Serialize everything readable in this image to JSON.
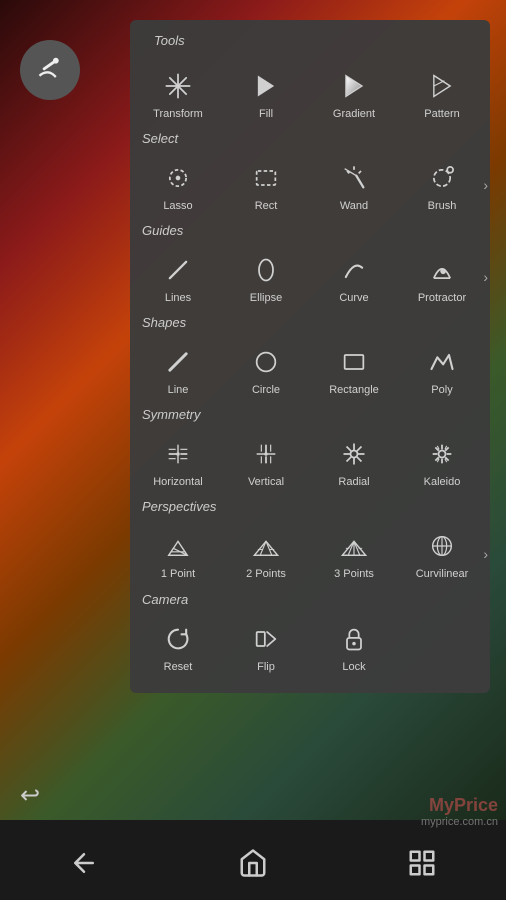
{
  "panel": {
    "title": "Tools"
  },
  "sections": [
    {
      "label": "",
      "tools": [
        {
          "name": "Transform",
          "icon": "move"
        },
        {
          "name": "Fill",
          "icon": "fill"
        },
        {
          "name": "Gradient",
          "icon": "gradient"
        },
        {
          "name": "Pattern",
          "icon": "pattern"
        }
      ],
      "hasArrow": false
    },
    {
      "label": "Select",
      "tools": [
        {
          "name": "Lasso",
          "icon": "lasso"
        },
        {
          "name": "Rect",
          "icon": "rect"
        },
        {
          "name": "Wand",
          "icon": "wand"
        },
        {
          "name": "Brush",
          "icon": "brush-sel"
        }
      ],
      "hasArrow": true
    },
    {
      "label": "Guides",
      "tools": [
        {
          "name": "Lines",
          "icon": "lines"
        },
        {
          "name": "Ellipse",
          "icon": "ellipse"
        },
        {
          "name": "Curve",
          "icon": "curve"
        },
        {
          "name": "Protractor",
          "icon": "protractor"
        }
      ],
      "hasArrow": true
    },
    {
      "label": "Shapes",
      "tools": [
        {
          "name": "Line",
          "icon": "line"
        },
        {
          "name": "Circle",
          "icon": "circle"
        },
        {
          "name": "Rectangle",
          "icon": "rectangle"
        },
        {
          "name": "Poly",
          "icon": "poly"
        }
      ],
      "hasArrow": false
    },
    {
      "label": "Symmetry",
      "tools": [
        {
          "name": "Horizontal",
          "icon": "horiz"
        },
        {
          "name": "Vertical",
          "icon": "vertical"
        },
        {
          "name": "Radial",
          "icon": "radial"
        },
        {
          "name": "Kaleido",
          "icon": "kaleido"
        }
      ],
      "hasArrow": false
    },
    {
      "label": "Perspectives",
      "tools": [
        {
          "name": "1 Point",
          "icon": "1point"
        },
        {
          "name": "2 Points",
          "icon": "2points"
        },
        {
          "name": "3 Points",
          "icon": "3points"
        },
        {
          "name": "Curvilinear",
          "icon": "curvilinear"
        }
      ],
      "hasArrow": true
    },
    {
      "label": "Camera",
      "tools": [
        {
          "name": "Reset",
          "icon": "reset"
        },
        {
          "name": "Flip",
          "icon": "flip"
        },
        {
          "name": "Lock",
          "icon": "lock"
        }
      ],
      "hasArrow": false
    }
  ],
  "nav": {
    "back": "←",
    "home": "⌂",
    "apps": "⊞"
  },
  "watermark": {
    "line1": "MyPrice",
    "line2": "myprice.com.cn"
  }
}
